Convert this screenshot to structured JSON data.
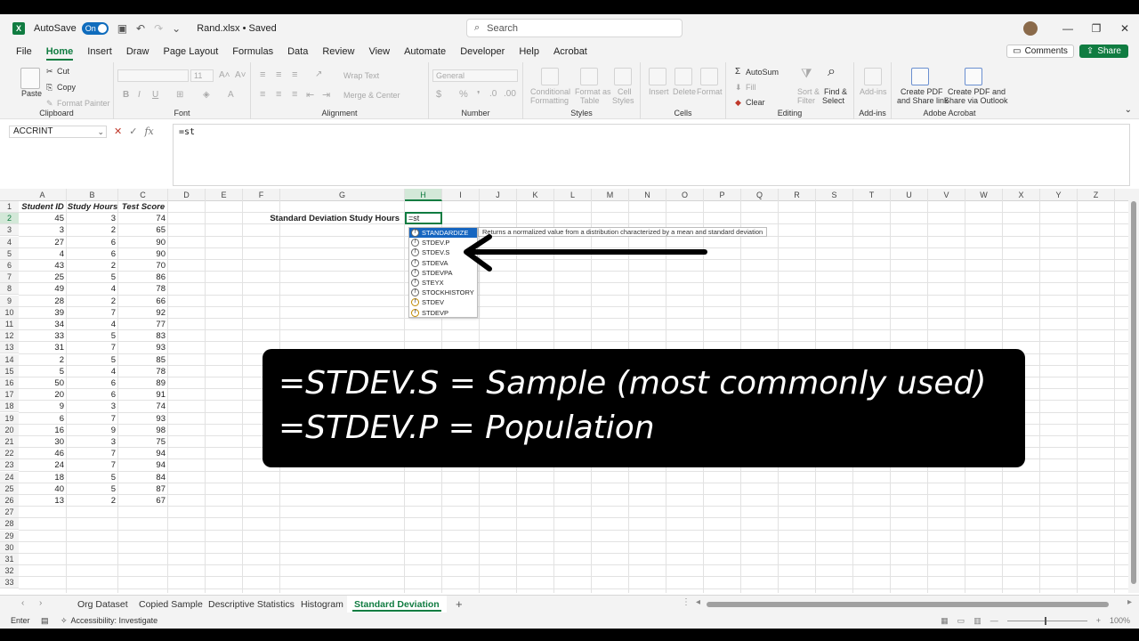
{
  "titlebar": {
    "autosave_label": "AutoSave",
    "autosave_state": "On",
    "filename": "Rand.xlsx • Saved",
    "search_placeholder": "Search",
    "undo_icon": "undo-icon",
    "redo_icon": "redo-icon"
  },
  "menu": {
    "tabs": [
      "File",
      "Home",
      "Insert",
      "Draw",
      "Page Layout",
      "Formulas",
      "Data",
      "Review",
      "View",
      "Automate",
      "Developer",
      "Help",
      "Acrobat"
    ],
    "active": "Home",
    "comments_label": "Comments",
    "share_label": "Share"
  },
  "ribbon": {
    "clipboard": {
      "label": "Clipboard",
      "paste": "Paste",
      "cut": "Cut",
      "copy": "Copy",
      "format_painter": "Format Painter"
    },
    "font": {
      "label": "Font",
      "size": "11"
    },
    "alignment": {
      "label": "Alignment",
      "wrap_text": "Wrap Text",
      "merge_center": "Merge & Center"
    },
    "number": {
      "label": "Number",
      "format": "General"
    },
    "styles": {
      "label": "Styles",
      "conditional": "Conditional",
      "conditional2": "Formatting",
      "format_as": "Format as",
      "format_as2": "Table",
      "cell": "Cell",
      "cell2": "Styles"
    },
    "cells": {
      "label": "Cells",
      "insert": "Insert",
      "delete": "Delete",
      "format": "Format"
    },
    "editing": {
      "label": "Editing",
      "autosum": "AutoSum",
      "fill": "Fill",
      "clear": "Clear",
      "sort": "Sort &",
      "sort2": "Filter",
      "find": "Find &",
      "find2": "Select"
    },
    "addins": {
      "label": "Add-ins",
      "btn": "Add-ins"
    },
    "acrobat": {
      "label": "Adobe Acrobat",
      "pdf_share": "Create PDF",
      "pdf_share2": "and Share link",
      "pdf_outlook": "Create PDF and",
      "pdf_outlook2": "Share via Outlook"
    }
  },
  "formula_bar": {
    "name_box": "ACCRINT",
    "formula": "=st"
  },
  "grid": {
    "columns": [
      "A",
      "B",
      "C",
      "D",
      "E",
      "F",
      "G",
      "H",
      "I",
      "J",
      "K",
      "L",
      "M",
      "N",
      "O",
      "P",
      "Q",
      "R",
      "S",
      "T",
      "U",
      "V",
      "W",
      "X",
      "Y",
      "Z"
    ],
    "row_count": 33,
    "headers": [
      "Student ID",
      "Study Hours",
      "Test Score"
    ],
    "rows": [
      [
        45,
        3,
        74
      ],
      [
        3,
        2,
        65
      ],
      [
        27,
        6,
        90
      ],
      [
        4,
        6,
        90
      ],
      [
        43,
        2,
        70
      ],
      [
        25,
        5,
        86
      ],
      [
        49,
        4,
        78
      ],
      [
        28,
        2,
        66
      ],
      [
        39,
        7,
        92
      ],
      [
        34,
        4,
        77
      ],
      [
        33,
        5,
        83
      ],
      [
        31,
        7,
        93
      ],
      [
        2,
        5,
        85
      ],
      [
        5,
        4,
        78
      ],
      [
        50,
        6,
        89
      ],
      [
        20,
        6,
        91
      ],
      [
        9,
        3,
        74
      ],
      [
        6,
        7,
        93
      ],
      [
        16,
        9,
        98
      ],
      [
        30,
        3,
        75
      ],
      [
        46,
        7,
        94
      ],
      [
        24,
        7,
        94
      ],
      [
        18,
        5,
        84
      ],
      [
        40,
        5,
        87
      ],
      [
        13,
        2,
        67
      ]
    ],
    "g2_label": "Standard Deviation Study Hours",
    "active_cell_text": "=st"
  },
  "autocomplete": {
    "items": [
      "STANDARDIZE",
      "STDEV.P",
      "STDEV.S",
      "STDEVA",
      "STDEVPA",
      "STEYX",
      "STOCKHISTORY",
      "STDEV",
      "STDEVP"
    ],
    "selected_index": 0,
    "tooltip": "Returns a normalized value from a distribution characterized by a mean and standard deviation"
  },
  "caption": {
    "line1": "=STDEV.S = Sample (most commonly used)",
    "line2": "=STDEV.P = Population"
  },
  "sheets": {
    "tabs": [
      "Org Dataset",
      "Copied Sample",
      "Descriptive Statistics",
      "Histogram",
      "Standard Deviation"
    ],
    "active": "Standard Deviation"
  },
  "status": {
    "mode": "Enter",
    "accessibility": "Accessibility: Investigate",
    "zoom": "100%"
  },
  "colors": {
    "excel_green": "#107c41",
    "selection_blue": "#1565c0",
    "caption_bg": "#000000"
  }
}
